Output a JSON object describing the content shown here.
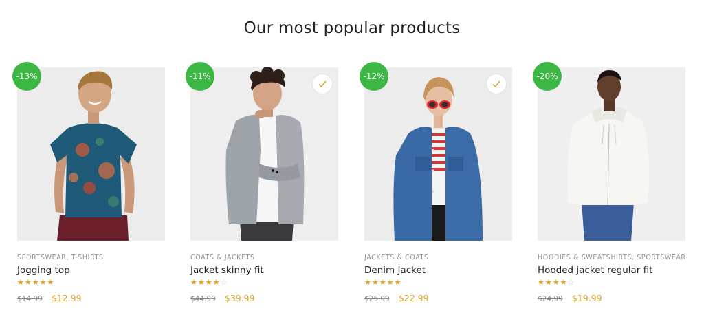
{
  "section": {
    "title": "Our most popular products"
  },
  "colors": {
    "accent_green": "#3cb744",
    "price_gold": "#d9a227",
    "star_gold": "#e2a017"
  },
  "products": [
    {
      "discount": "-13%",
      "wishlisted": false,
      "categories": [
        "SPORTSWEAR",
        "T-SHIRTS"
      ],
      "cat_sep": ",",
      "name": "Jogging top",
      "rating": 5,
      "stars": "★★★★★",
      "old_price": "$14.99",
      "price": "$12.99"
    },
    {
      "discount": "-11%",
      "wishlisted": true,
      "categories": [
        "COATS & JACKETS"
      ],
      "cat_sep": "",
      "name": "Jacket skinny fit",
      "rating": 4,
      "stars": "★★★★☆",
      "old_price": "$44.99",
      "price": "$39.99"
    },
    {
      "discount": "-12%",
      "wishlisted": true,
      "categories": [
        "JACKETS & COATS"
      ],
      "cat_sep": "",
      "name": "Denim Jacket",
      "rating": 5,
      "stars": "★★★★★",
      "old_price": "$25.99",
      "price": "$22.99"
    },
    {
      "discount": "-20%",
      "wishlisted": false,
      "categories": [
        "HOODIES & SWEATSHIRTS",
        "SPORTSWEAR"
      ],
      "cat_sep": ",",
      "name": "Hooded jacket regular fit",
      "rating": 4,
      "stars": "★★★★☆",
      "old_price": "$24.99",
      "price": "$19.99"
    }
  ]
}
